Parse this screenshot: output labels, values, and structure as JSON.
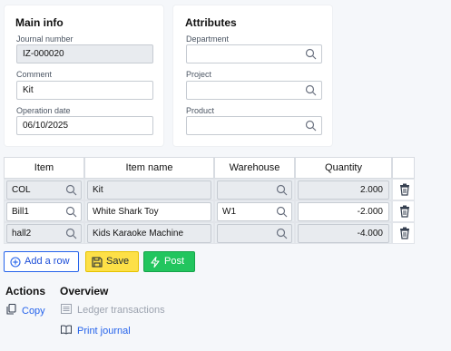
{
  "main_info": {
    "title": "Main info",
    "journal_number_label": "Journal number",
    "journal_number": "IZ-000020",
    "comment_label": "Comment",
    "comment": "Kit",
    "operation_date_label": "Operation date",
    "operation_date": "06/10/2025"
  },
  "attributes": {
    "title": "Attributes",
    "department_label": "Department",
    "department": "",
    "project_label": "Project",
    "project": "",
    "product_label": "Product",
    "product": ""
  },
  "table": {
    "headers": [
      "Item",
      "Item name",
      "Warehouse",
      "Quantity"
    ],
    "rows": [
      {
        "item": "COL",
        "item_name": "Kit",
        "warehouse": "",
        "quantity": "2.000"
      },
      {
        "item": "Bill1",
        "item_name": "White Shark Toy",
        "warehouse": "W1",
        "quantity": "-2.000"
      },
      {
        "item": "hall2",
        "item_name": "Kids Karaoke Machine",
        "warehouse": "",
        "quantity": "-4.000"
      }
    ]
  },
  "buttons": {
    "add_row": "Add a row",
    "save": "Save",
    "post": "Post"
  },
  "actions": {
    "title": "Actions",
    "copy": "Copy"
  },
  "overview": {
    "title": "Overview",
    "ledger": "Ledger transactions",
    "print": "Print journal"
  },
  "colors": {
    "accent": "#2563eb",
    "save": "#fde047",
    "post": "#22c55e"
  }
}
